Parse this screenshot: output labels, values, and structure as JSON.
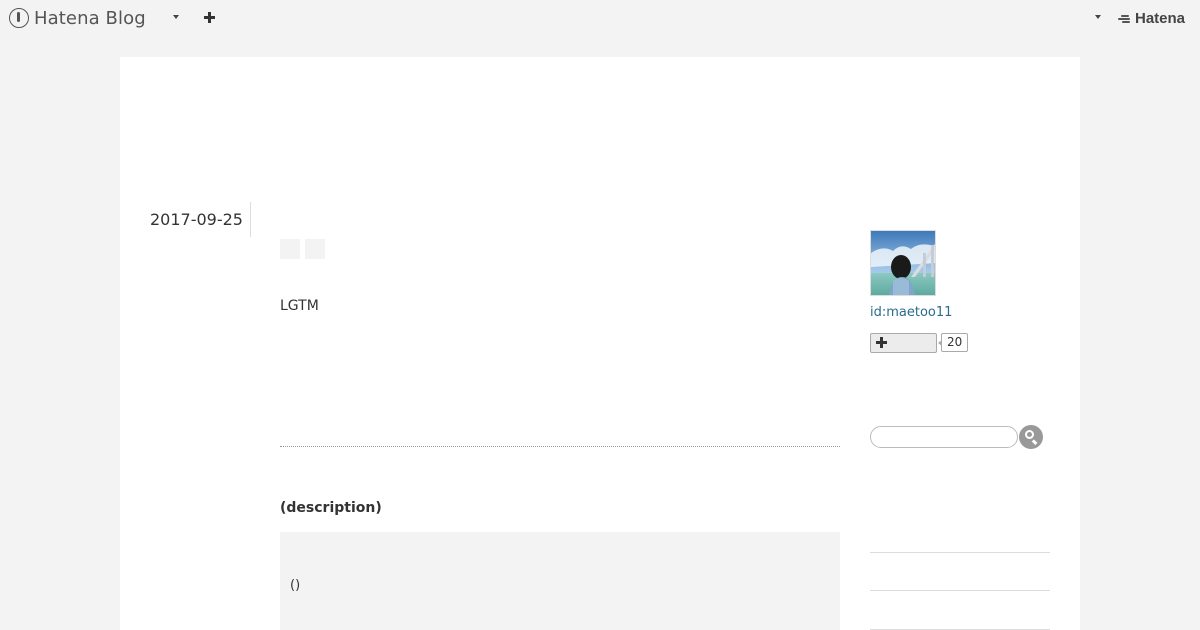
{
  "header": {
    "brand": "Hatena Blog",
    "account_logo": "Hatena",
    "icons": {
      "brand": "hatena-blog-logo-icon",
      "menu": "chevron-down-icon",
      "add": "plus-icon",
      "account_menu": "chevron-down-icon"
    }
  },
  "entry": {
    "date": "2017-09-25",
    "body": "LGTM",
    "section_heading": "(description)",
    "code": "()"
  },
  "sidebar": {
    "author_id": "id:maetoo11",
    "follow": {
      "icon": "plus-icon",
      "count": "20"
    },
    "search": {
      "value": "",
      "placeholder": "",
      "button_icon": "search-icon"
    }
  },
  "colors": {
    "background": "#f3f3f3",
    "card": "#ffffff",
    "link": "#2b6c8c",
    "text": "#333333"
  }
}
